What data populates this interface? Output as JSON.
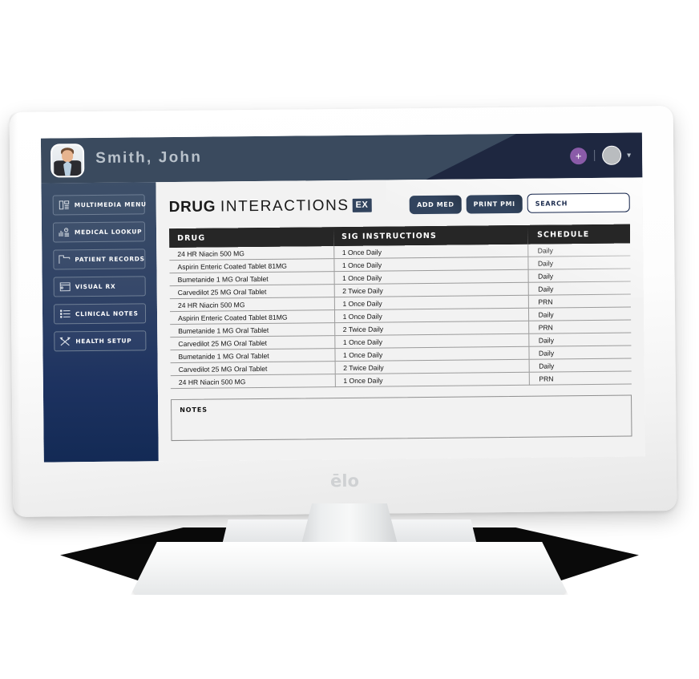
{
  "device": {
    "brand": "ēlo"
  },
  "topbar": {
    "patient_name": "Smith, John",
    "add_icon": "plus-icon",
    "avatar_icon": "user-avatar",
    "chevron_icon": "chevron-down-icon",
    "accent_purple": "#8a5ba8",
    "bg": "#3a4a5e",
    "bg_dark": "#1e2740"
  },
  "sidebar": {
    "items": [
      {
        "label": "MULTIMEDIA MENU",
        "icon": "multimedia-icon"
      },
      {
        "label": "MEDICAL LOOKUP",
        "icon": "chart-clock-icon"
      },
      {
        "label": "PATIENT RECORDS",
        "icon": "folder-icon"
      },
      {
        "label": "VISUAL RX",
        "icon": "window-icon"
      },
      {
        "label": "CLINICAL NOTES",
        "icon": "list-icon"
      },
      {
        "label": "HEALTH SETUP",
        "icon": "tools-icon"
      }
    ]
  },
  "page": {
    "title_bold": "DRUG",
    "title_light": "INTERACTIONS",
    "title_badge": "EX"
  },
  "toolbar": {
    "add_med_label": "ADD MED",
    "print_pmi_label": "PRINT PMI",
    "search_label": "SEARCH",
    "search_placeholder": "SEARCH"
  },
  "table": {
    "columns": [
      "DRUG",
      "SIG INSTRUCTIONS",
      "SCHEDULE"
    ],
    "rows": [
      [
        "24 HR Niacin 500 MG",
        "1 Once Daily",
        "Daily"
      ],
      [
        "Aspirin Enteric Coated Tablet 81MG",
        "1 Once Daily",
        "Daily"
      ],
      [
        "Bumetanide 1 MG Oral Tablet",
        "1 Once Daily",
        "Daily"
      ],
      [
        "Carvedilot 25 MG Oral Tablet",
        "2 Twice Daily",
        "Daily"
      ],
      [
        "24 HR Niacin 500 MG",
        "1 Once Daily",
        "PRN"
      ],
      [
        "Aspirin Enteric Coated Tablet 81MG",
        "1 Once Daily",
        "Daily"
      ],
      [
        "Bumetanide 1 MG Oral Tablet",
        "2 Twice Daily",
        "PRN"
      ],
      [
        "Carvedilot 25 MG Oral Tablet",
        "1 Once Daily",
        "Daily"
      ],
      [
        "Bumetanide 1 MG Oral Tablet",
        "1 Once Daily",
        "Daily"
      ],
      [
        "Carvedilot 25 MG Oral Tablet",
        "2 Twice Daily",
        "Daily"
      ],
      [
        "24 HR Niacin 500 MG",
        "1 Once Daily",
        "PRN"
      ]
    ]
  },
  "notes": {
    "label": "NOTES",
    "value": ""
  }
}
